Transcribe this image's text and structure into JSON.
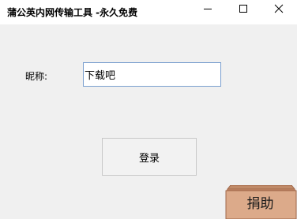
{
  "window": {
    "title": "蒲公英内网传输工具 -永久免费"
  },
  "form": {
    "nickname_label": "昵称:",
    "nickname_value": "下载吧",
    "login_label": "登录"
  },
  "donate": {
    "label": "捐助",
    "box_color": "#dcaa8a",
    "box_edge_color": "#a0684a"
  },
  "icons": {
    "minimize": "minimize-icon",
    "maximize": "maximize-icon",
    "close": "close-icon"
  }
}
